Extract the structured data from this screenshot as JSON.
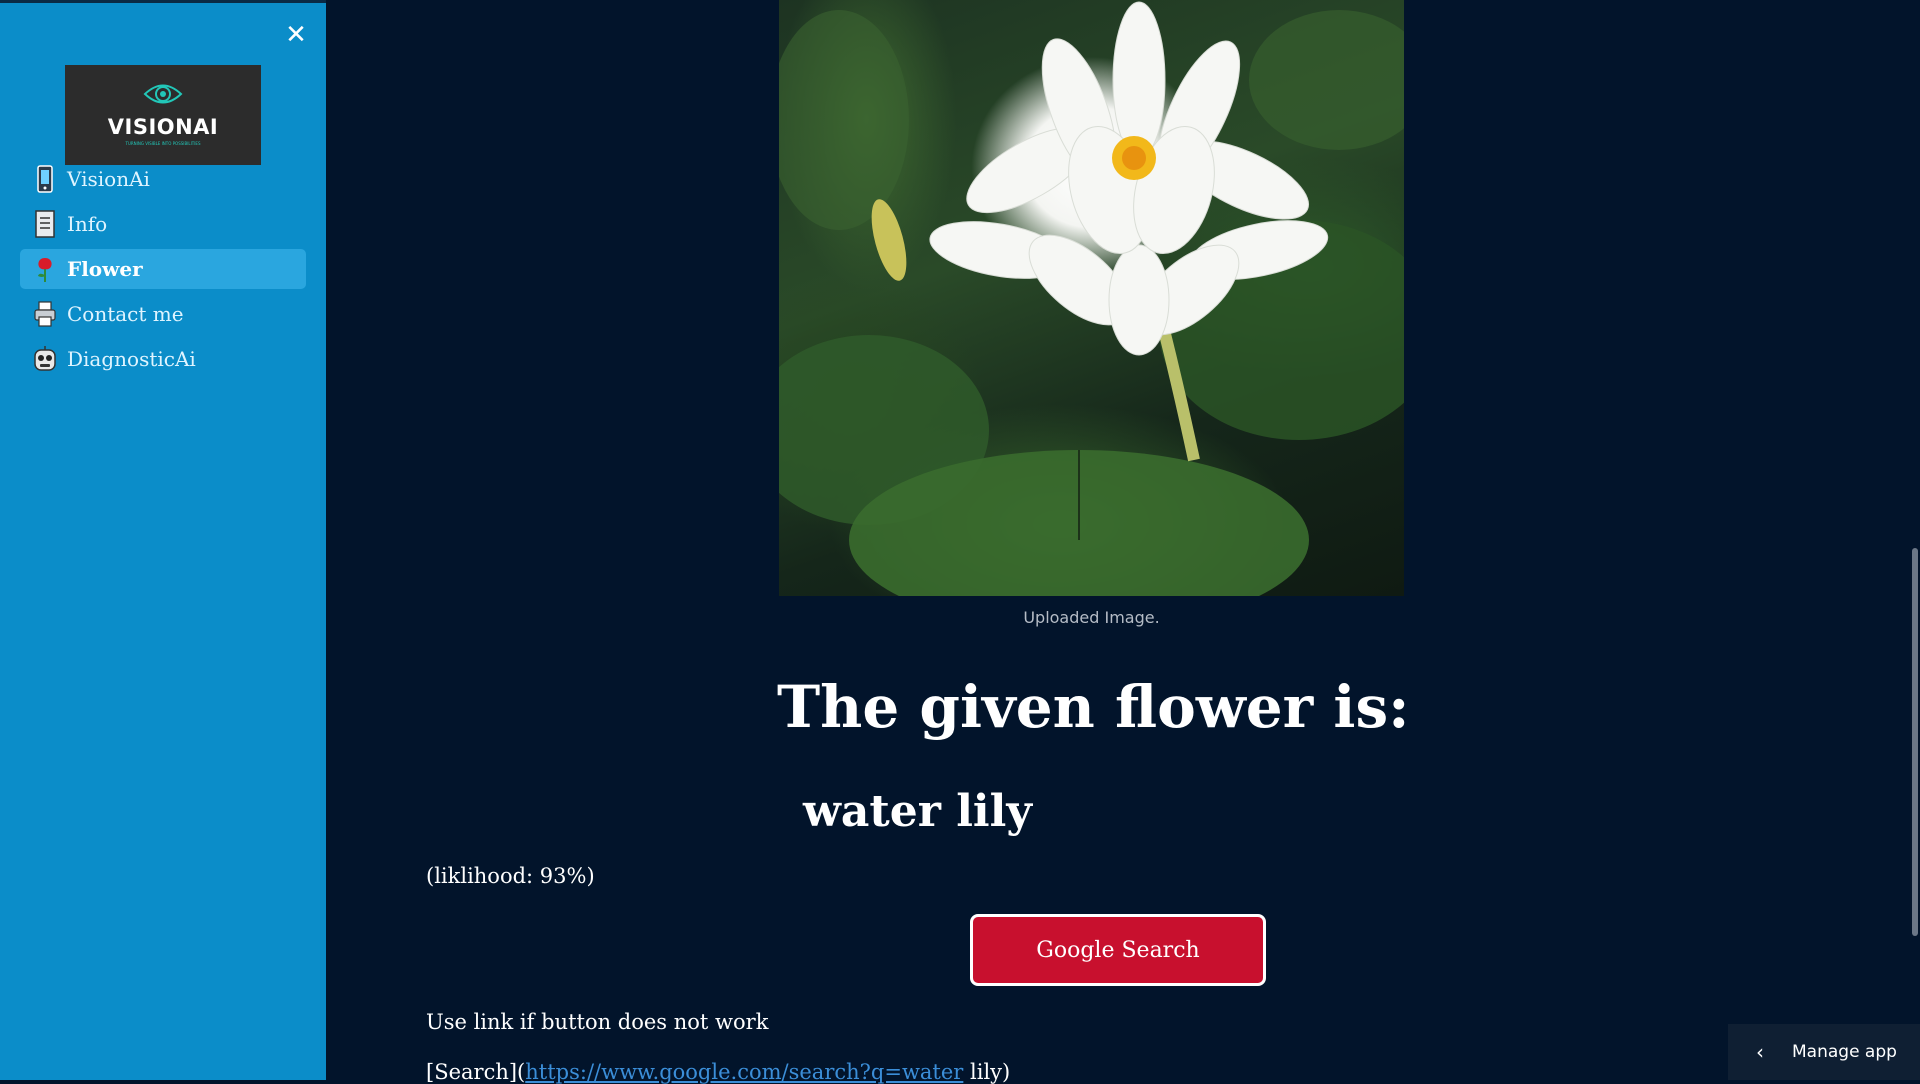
{
  "sidebar": {
    "logo_text": "VISIONAI",
    "logo_tagline": "TURNING VISIBLE INTO POSSIBILITIES",
    "items": [
      {
        "label": "VisionAi",
        "icon": "phone-icon",
        "active": false
      },
      {
        "label": "Info",
        "icon": "document-icon",
        "active": false
      },
      {
        "label": "Flower",
        "icon": "rose-icon",
        "active": true
      },
      {
        "label": "Contact me",
        "icon": "printer-icon",
        "active": false
      },
      {
        "label": "DiagnosticAi",
        "icon": "robot-face-icon",
        "active": false
      }
    ]
  },
  "main": {
    "image_caption": "Uploaded Image.",
    "heading": "The given flower is:",
    "result": "water lily",
    "likelihood": "(liklihood: 93%)",
    "search_button": "Google Search",
    "hint": "Use link if button does not work",
    "link_prefix": "[Search](",
    "link_url": "https://www.google.com/search?q=water",
    "link_suffix": " lily)"
  },
  "footer": {
    "manage_app": "Manage app"
  },
  "colors": {
    "sidebar_bg": "#0b8dc9",
    "sidebar_active": "#2aa6df",
    "main_bg": "#02142b",
    "button_red": "#c8102e",
    "link_blue": "#3b8ed8"
  }
}
